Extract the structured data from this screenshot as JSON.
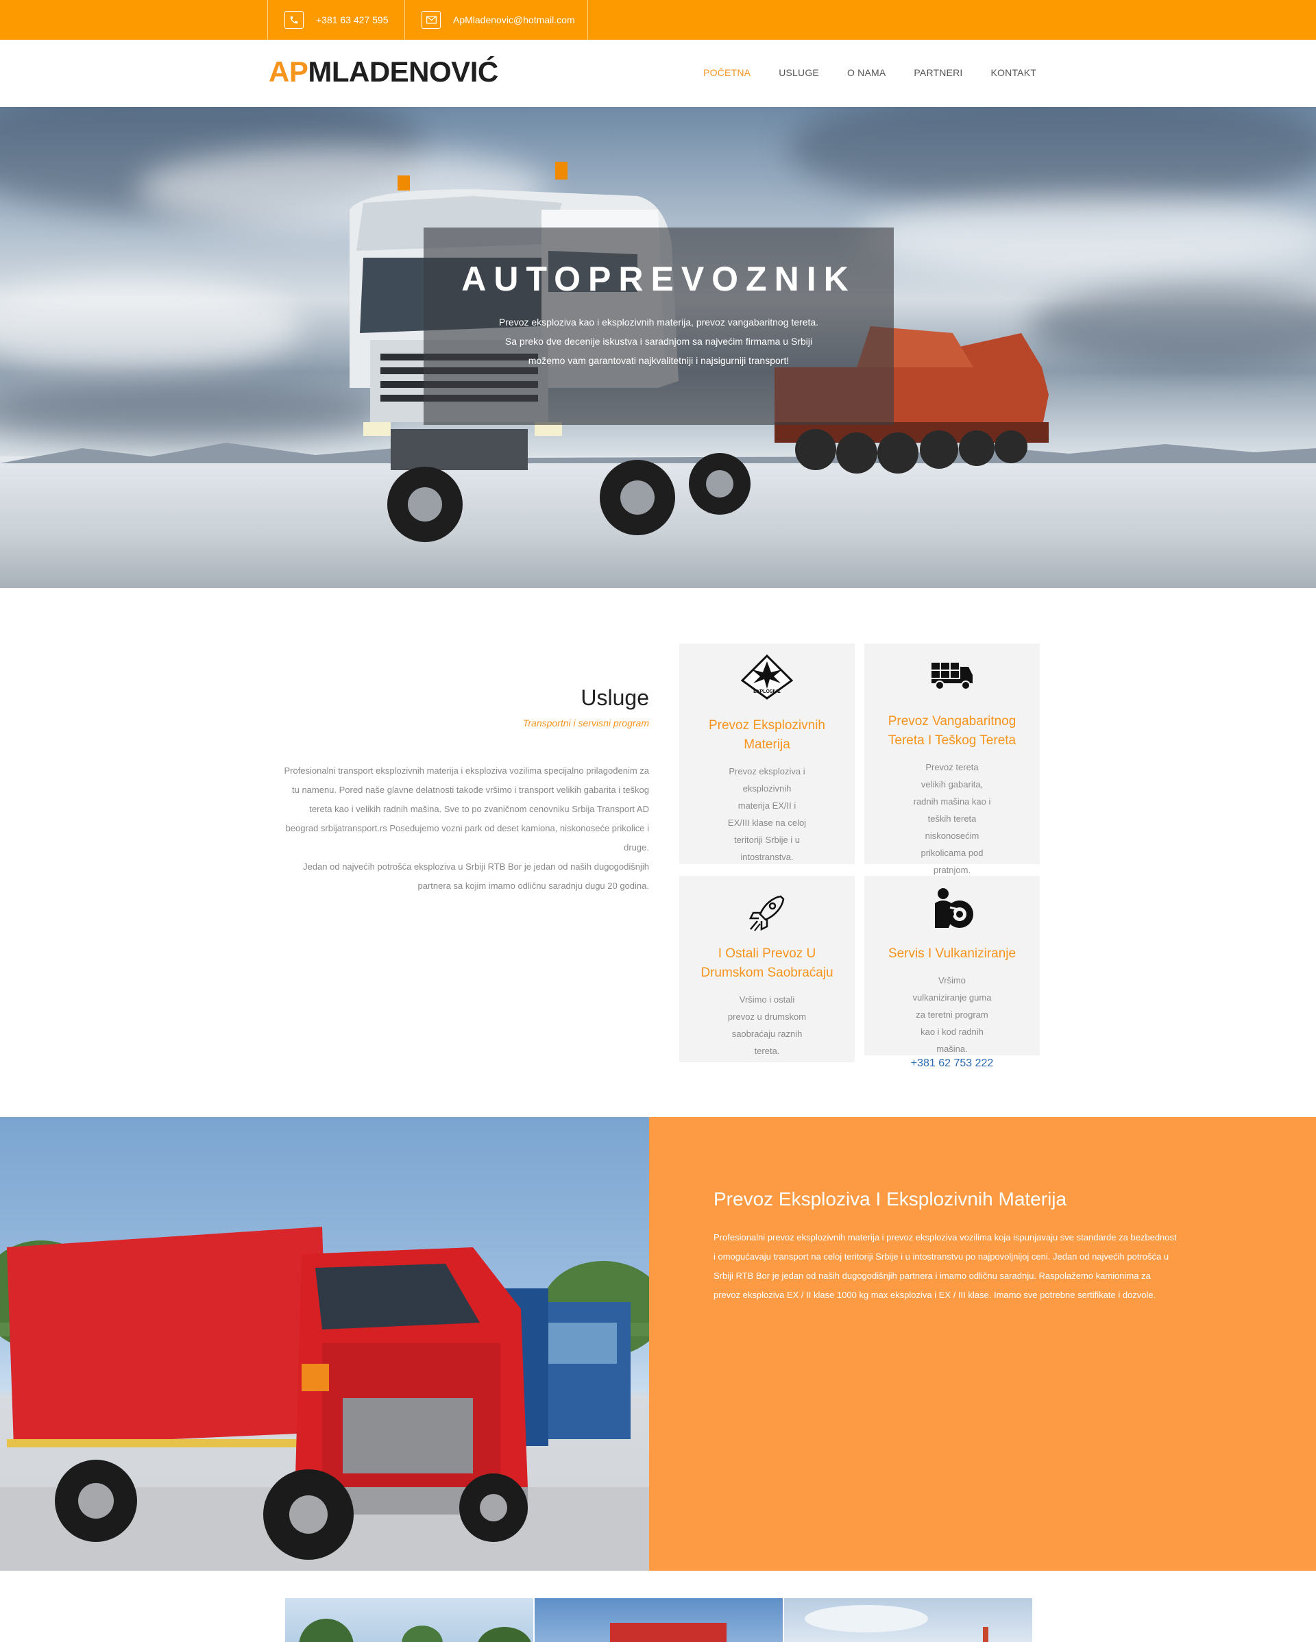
{
  "topbar": {
    "phone": "+381 63 427 595",
    "email": "ApMladenovic@hotmail.com",
    "phone_icon": "phone-icon",
    "email_icon": "mail-icon"
  },
  "header": {
    "logo_ap": "AP",
    "logo_name": "MLADENOVIĆ",
    "nav": [
      "Početna",
      "Usluge",
      "O nama",
      "Partneri",
      "Kontakt"
    ],
    "active_nav": "Početna"
  },
  "hero": {
    "title": "AUTOPREVOZNIK",
    "line1": "Prevoz eksploziva kao i eksplozivnih materija, prevoz vangabaritnog tereta.",
    "line2": "Sa preko dve decenije iskustva i saradnjom sa najvećim firmama u Srbiji",
    "line3": "možemo vam garantovati najkvalitetniji i najsigurniji transport!"
  },
  "services": {
    "title": "Usluge",
    "subtitle": "Transportni i servisni program",
    "body": "Profesionalni transport eksplozivnih materija i eksploziva vozilima specijalno prilagođenim za tu namenu. Pored naše glavne delatnosti takođe vršimo i transport velikih gabarita i teškog tereta kao i velikih radnih mašina. Sve to po zvaničnom cenovniku Srbija Transport AD beograd srbijatransport.rs Posedujemo vozni park od deset kamiona, niskonoseće prikolice i druge.",
    "body2": "Jedan od najvećih potrošća eksploziva u Srbiji RTB Bor je jedan od naših dugogodišnjih partnera sa kojim imamo odličnu saradnju dugu 20 godina.",
    "cards": [
      {
        "icon": "explosive-icon",
        "title": "Prevoz Eksplozivnih Materija",
        "text": "Prevoz eksploziva i eksplozivnih materija EX/II i EX/III klase na celoj teritoriji Srbije i u intostranstva."
      },
      {
        "icon": "truck-icon",
        "title": "Prevoz Vangabaritnog Tereta I Teškog Tereta",
        "text": "Prevoz tereta velikih gabarita, radnih mašina kao i teških tereta niskonosećim prikolicama pod pratnjom."
      },
      {
        "icon": "rocket-icon",
        "title": "I Ostali Prevoz U Drumskom Saobraćaju",
        "text": "Vršimo i ostali prevoz u drumskom saobraćaju raznih tereta."
      },
      {
        "icon": "mechanic-icon",
        "title": "Servis I Vulkaniziranje",
        "text": "Vršimo vulkaniziranje guma za teretni program kao i kod radnih mašina.",
        "phone": "+381 62 753 222"
      }
    ],
    "explosive_label": "EXPLOSIVE"
  },
  "explosives": {
    "title": "Prevoz Eksploziva I Eksplozivnih Materija",
    "text": "Profesionalni prevoz eksplozivnih materija i prevoz eksploziva vozilima koja ispunjavaju sve standarde za bezbednost i omogućavaju transport na celoj teritoriji Srbije i u intostranstvu po najpovoljnijoj ceni. Jedan od najvećih potrošća u Srbiji RTB Bor je jedan od naših dugogodišnjih partnera i imamo odličnu saradnju. Raspolažemo kamionima za prevoz eksploziva EX / II klase 1000 kg max eksploziva i EX / III klase. Imamo sve potrebne sertifikate i dozvole."
  },
  "colors": {
    "accent": "#fd9a00",
    "orange_text": "#f7941d",
    "panel": "#fd9b45",
    "link": "#2a6ab3"
  }
}
